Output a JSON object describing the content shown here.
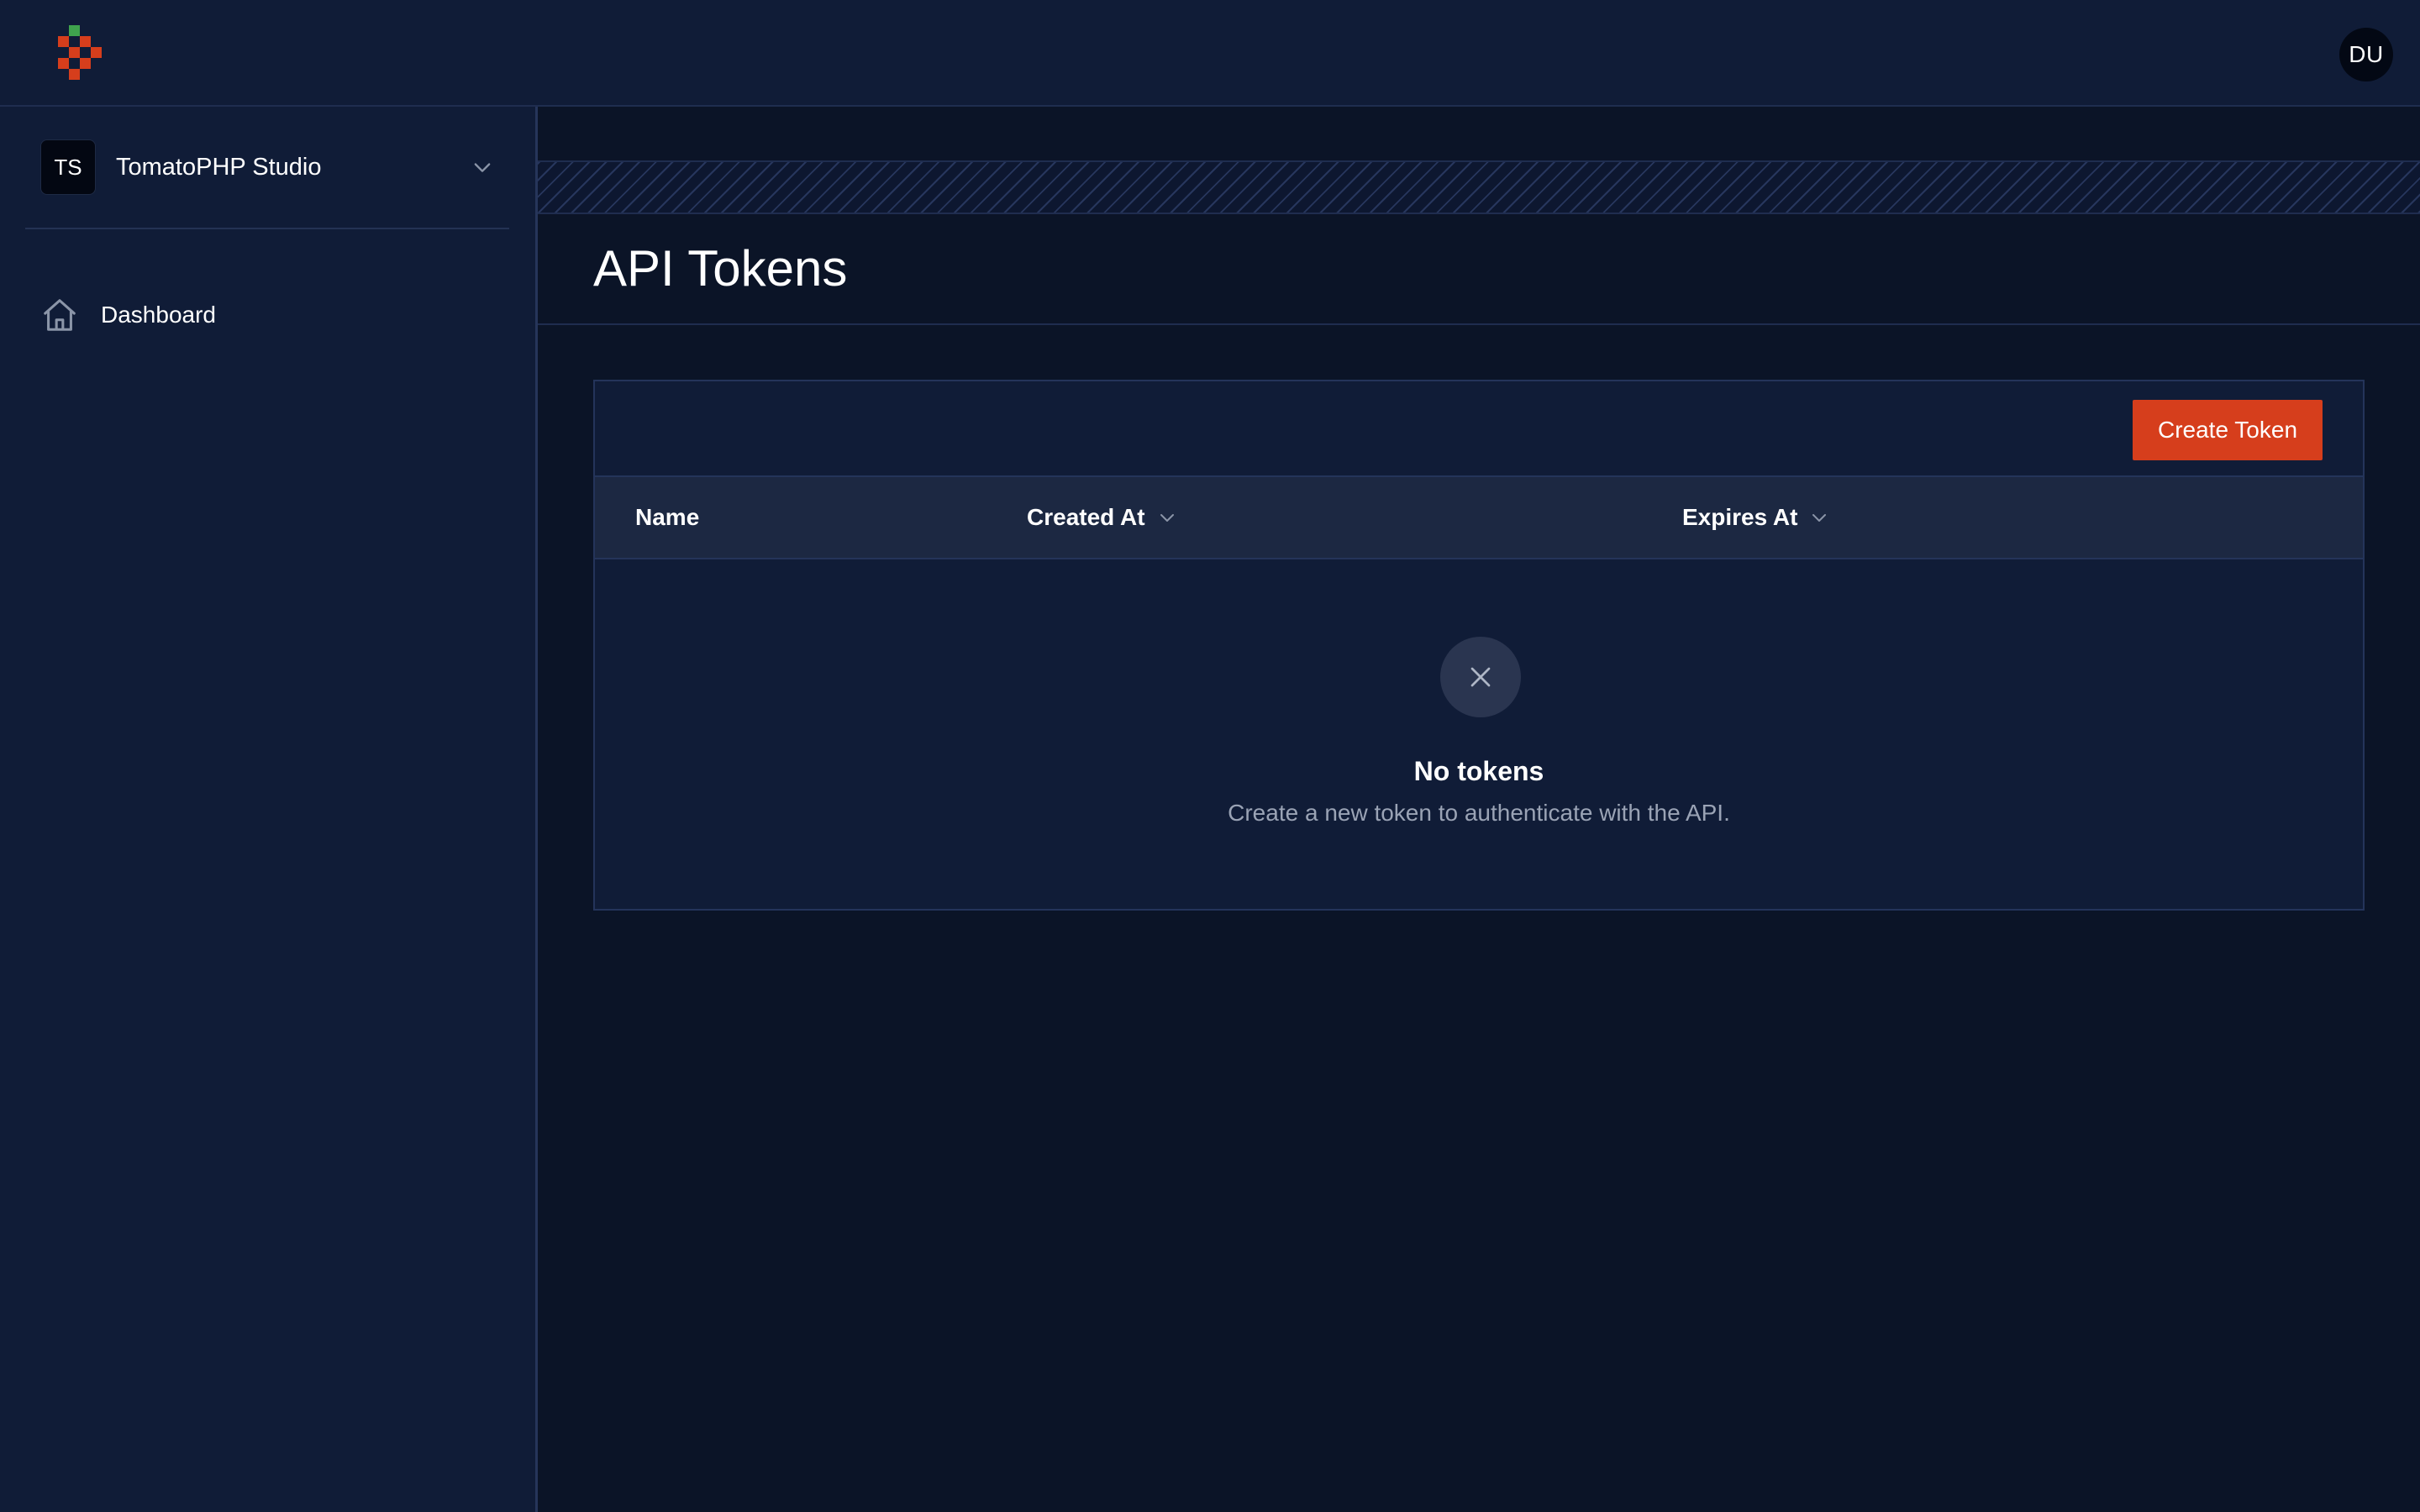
{
  "app": {
    "title": "TomatoPHP Studio",
    "accent_color": "#d63e1c",
    "logo_icon": "tomato-pixel-logo"
  },
  "user": {
    "initials": "DU"
  },
  "team": {
    "badge": "TS",
    "name": "TomatoPHP Studio"
  },
  "sidebar": {
    "items": [
      {
        "label": "Dashboard",
        "icon": "home-icon"
      }
    ]
  },
  "page": {
    "title": "API Tokens"
  },
  "toolbar": {
    "create_label": "Create Token"
  },
  "table": {
    "columns": [
      {
        "label": "Name",
        "sortable": false
      },
      {
        "label": "Created At",
        "sortable": true
      },
      {
        "label": "Expires At",
        "sortable": true
      }
    ],
    "rows": []
  },
  "empty_state": {
    "icon": "close-icon",
    "title": "No tokens",
    "description": "Create a new token to authenticate with the API."
  }
}
